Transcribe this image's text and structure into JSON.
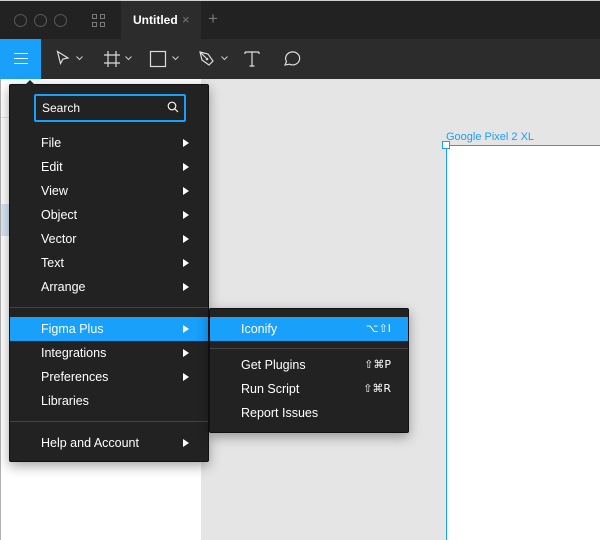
{
  "window": {
    "traffic_lights": [
      "close",
      "minimize",
      "maximize"
    ],
    "grid_icon": "grid-icon"
  },
  "tabs": [
    {
      "label": "Untitled",
      "close": "×",
      "active": true
    }
  ],
  "tab_add": "+",
  "toolbar": {
    "menu_icon": "hamburger-icon",
    "tools": [
      {
        "name": "move-tool",
        "icon": "cursor-arrow-icon",
        "has_dropdown": true
      },
      {
        "name": "frame-tool",
        "icon": "frame-hash-icon",
        "has_dropdown": true
      },
      {
        "name": "shape-tool",
        "icon": "rectangle-icon",
        "has_dropdown": true
      },
      {
        "name": "pen-tool",
        "icon": "pen-nib-icon",
        "has_dropdown": true
      },
      {
        "name": "text-tool",
        "icon": "text-T-icon",
        "has_dropdown": false
      },
      {
        "name": "comment-tool",
        "icon": "speech-bubble-icon",
        "has_dropdown": false
      }
    ]
  },
  "main_menu": {
    "search": {
      "placeholder": "Search",
      "value": ""
    },
    "groups": [
      [
        {
          "label": "File",
          "submenu": true
        },
        {
          "label": "Edit",
          "submenu": true
        },
        {
          "label": "View",
          "submenu": true
        },
        {
          "label": "Object",
          "submenu": true
        },
        {
          "label": "Vector",
          "submenu": true
        },
        {
          "label": "Text",
          "submenu": true
        },
        {
          "label": "Arrange",
          "submenu": true
        }
      ],
      [
        {
          "label": "Figma Plus",
          "submenu": true,
          "active": true
        },
        {
          "label": "Integrations",
          "submenu": true
        },
        {
          "label": "Preferences",
          "submenu": true
        },
        {
          "label": "Libraries",
          "submenu": false
        }
      ],
      [
        {
          "label": "Help and Account",
          "submenu": true
        }
      ]
    ]
  },
  "figma_plus_submenu": {
    "items": [
      {
        "label": "Iconify",
        "shortcut": "⌥⇧I",
        "active": true
      },
      {
        "label": "Get Plugins",
        "shortcut": "⇧⌘P"
      },
      {
        "label": "Run Script",
        "shortcut": "⇧⌘R"
      },
      {
        "label": "Report Issues",
        "shortcut": ""
      }
    ]
  },
  "canvas": {
    "frame_label": "Google Pixel 2 XL",
    "accent": "#18a0fb",
    "background": "#e5e5e5"
  }
}
